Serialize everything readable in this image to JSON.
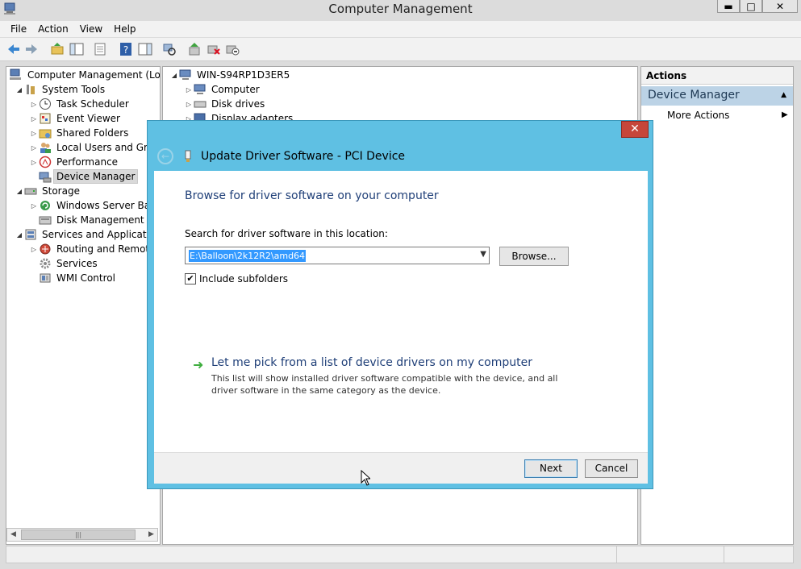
{
  "window": {
    "title": "Computer Management",
    "min_glyph": "▬",
    "max_glyph": "□",
    "close_glyph": "✕"
  },
  "menu": [
    "File",
    "Action",
    "View",
    "Help"
  ],
  "tree": {
    "root": "Computer Management (Local",
    "system_tools": "System Tools",
    "task_scheduler": "Task Scheduler",
    "event_viewer": "Event Viewer",
    "shared_folders": "Shared Folders",
    "local_users": "Local Users and Grou",
    "performance": "Performance",
    "device_manager": "Device Manager",
    "storage": "Storage",
    "windows_backup": "Windows Server Back",
    "disk_management": "Disk Management",
    "services_apps": "Services and Application",
    "routing": "Routing and Remote",
    "services": "Services",
    "wmi": "WMI Control"
  },
  "devices": {
    "host": "WIN-S94RP1D3ER5",
    "computer": "Computer",
    "disk_drives": "Disk drives",
    "display_adapters": "Display adapters"
  },
  "actions": {
    "header": "Actions",
    "group": "Device Manager",
    "more": "More Actions"
  },
  "dialog": {
    "title": "Update Driver Software - PCI Device",
    "heading": "Browse for driver software on your computer",
    "search_label": "Search for driver software in this location:",
    "path_value": "E:\\Balloon\\2k12R2\\amd64",
    "browse_label": "Browse...",
    "include_subfolders": "Include subfolders",
    "include_checked": "✔",
    "pick_link": "Let me pick from a list of device drivers on my computer",
    "pick_desc": "This list will show installed driver software compatible with the device, and all driver software in the same category as the device.",
    "next_label": "Next",
    "cancel_label": "Cancel",
    "close_glyph": "✕"
  }
}
